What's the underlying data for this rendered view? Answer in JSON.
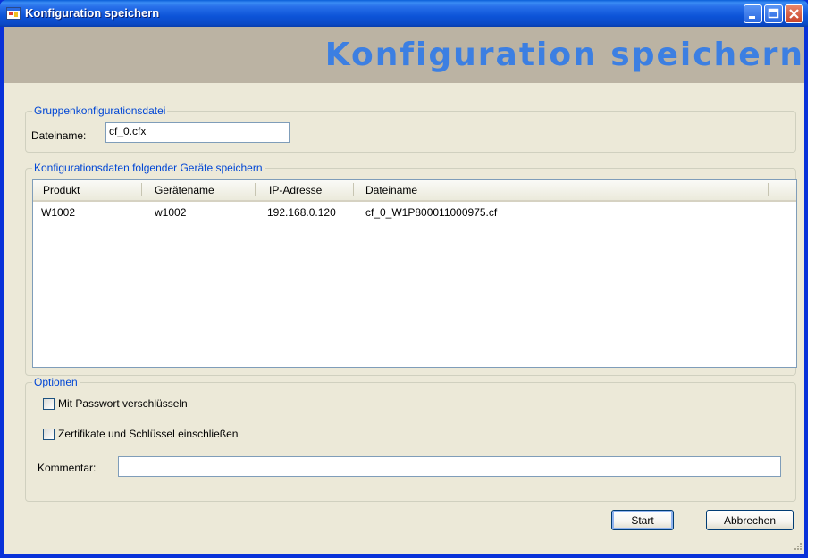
{
  "window": {
    "title": "Konfiguration speichern",
    "icon": "app-window-icon",
    "controls": [
      "minimize-icon",
      "maximize-icon",
      "close-icon"
    ]
  },
  "banner": {
    "title": "Konfiguration speichern"
  },
  "group_file": {
    "legend": "Gruppenkonfigurationsdatei",
    "filename_label": "Dateiname:",
    "filename_value": "cf_0.cfx"
  },
  "group_devices": {
    "legend": "Konfigurationsdaten folgender Geräte speichern",
    "columns": [
      "Produkt",
      "Gerätename",
      "IP-Adresse",
      "Dateiname"
    ],
    "rows": [
      [
        "W1002",
        "w1002",
        "192.168.0.120",
        "cf_0_W1P800011000975.cf"
      ]
    ]
  },
  "group_options": {
    "legend": "Optionen",
    "encrypt_label": "Mit Passwort verschlüsseln",
    "encrypt_checked": false,
    "certs_label": "Zertifikate und Schlüssel einschließen",
    "certs_checked": false,
    "comment_label": "Kommentar:",
    "comment_value": ""
  },
  "buttons": {
    "start": "Start",
    "cancel": "Abbrechen"
  },
  "colors": {
    "titlebar": "#0a5fd8",
    "banner_bg": "#bbb3a3",
    "banner_text": "#3c7fe2",
    "dialog_bg": "#ece9d8",
    "legend_text": "#0046d5"
  }
}
